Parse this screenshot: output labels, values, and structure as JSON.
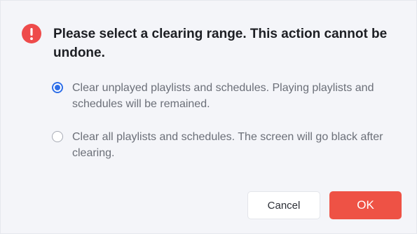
{
  "dialog": {
    "message": "Please select a clearing range. This action cannot be undone.",
    "icon": "exclamation-circle-icon",
    "icon_glyph": "!",
    "options": [
      {
        "label": "Clear unplayed playlists and schedules. Playing playlists and schedules will be remained.",
        "selected": true
      },
      {
        "label": "Clear all playlists and schedules. The screen will go black after clearing.",
        "selected": false
      }
    ],
    "buttons": {
      "cancel_label": "Cancel",
      "ok_label": "OK"
    }
  },
  "colors": {
    "accent": "#2f6fe8",
    "danger": "#ee4b4b",
    "ok_button": "#ee5245",
    "background": "#f4f5f9"
  }
}
